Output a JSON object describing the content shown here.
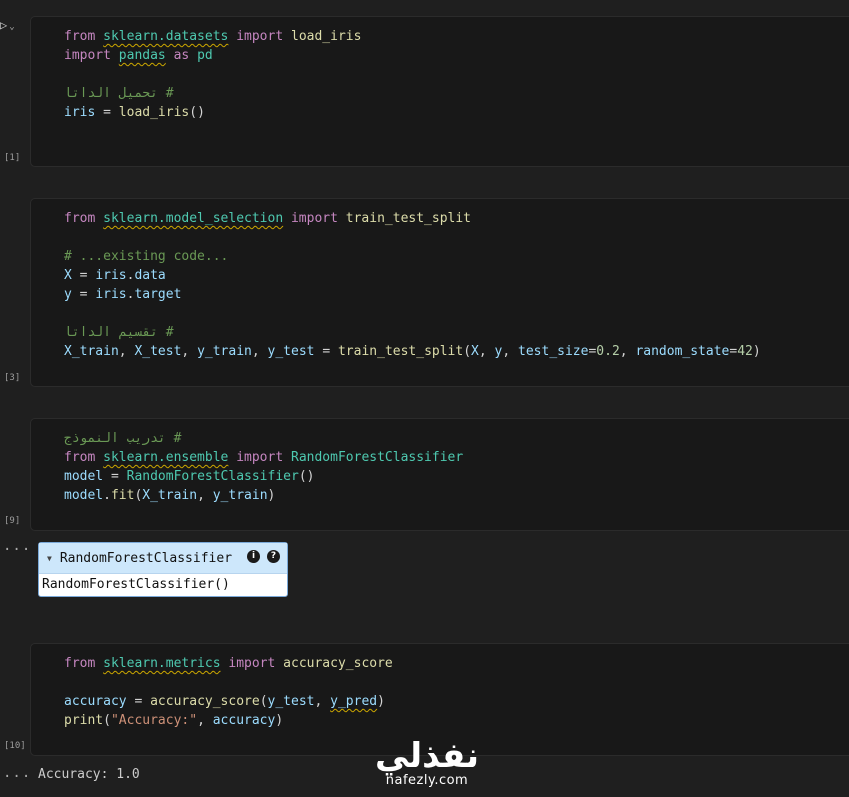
{
  "cells": [
    {
      "exec_count": "[1]",
      "lines": [
        [
          [
            "kw",
            "from "
          ],
          [
            "mod sq",
            "sklearn.datasets"
          ],
          [
            "kw",
            " import "
          ],
          [
            "fn",
            "load_iris"
          ]
        ],
        [
          [
            "kw",
            "import "
          ],
          [
            "mod sq",
            "pandas"
          ],
          [
            "kw",
            " as "
          ],
          [
            "mod",
            "pd"
          ]
        ],
        [],
        [
          [
            "cmt",
            "# تحميل الداتا"
          ]
        ],
        [
          [
            "var",
            "iris"
          ],
          [
            "pln",
            " = "
          ],
          [
            "fn",
            "load_iris"
          ],
          [
            "pln",
            "()"
          ]
        ]
      ]
    },
    {
      "exec_count": "[3]",
      "lines": [
        [
          [
            "kw",
            "from "
          ],
          [
            "mod sq",
            "sklearn.model_selection"
          ],
          [
            "kw",
            " import "
          ],
          [
            "fn",
            "train_test_split"
          ]
        ],
        [],
        [
          [
            "cmt",
            "# ...existing code..."
          ]
        ],
        [
          [
            "var",
            "X"
          ],
          [
            "pln",
            " = "
          ],
          [
            "var",
            "iris"
          ],
          [
            "pln",
            "."
          ],
          [
            "var",
            "data"
          ]
        ],
        [
          [
            "var",
            "y"
          ],
          [
            "pln",
            " = "
          ],
          [
            "var",
            "iris"
          ],
          [
            "pln",
            "."
          ],
          [
            "var",
            "target"
          ]
        ],
        [],
        [
          [
            "cmt",
            "# تقسيم الداتا"
          ]
        ],
        [
          [
            "var",
            "X_train"
          ],
          [
            "pln",
            ", "
          ],
          [
            "var",
            "X_test"
          ],
          [
            "pln",
            ", "
          ],
          [
            "var",
            "y_train"
          ],
          [
            "pln",
            ", "
          ],
          [
            "var",
            "y_test"
          ],
          [
            "pln",
            " = "
          ],
          [
            "fn",
            "train_test_split"
          ],
          [
            "pln",
            "("
          ],
          [
            "var",
            "X"
          ],
          [
            "pln",
            ", "
          ],
          [
            "var",
            "y"
          ],
          [
            "pln",
            ", "
          ],
          [
            "var",
            "test_size"
          ],
          [
            "pln",
            "="
          ],
          [
            "num",
            "0.2"
          ],
          [
            "pln",
            ", "
          ],
          [
            "var",
            "random_state"
          ],
          [
            "pln",
            "="
          ],
          [
            "num",
            "42"
          ],
          [
            "pln",
            ")"
          ]
        ]
      ]
    },
    {
      "exec_count": "[9]",
      "lines": [
        [
          [
            "cmt",
            "# تدريب النموذج"
          ]
        ],
        [
          [
            "kw",
            "from "
          ],
          [
            "mod sq",
            "sklearn.ensemble"
          ],
          [
            "kw",
            " import "
          ],
          [
            "cls",
            "RandomForestClassifier"
          ]
        ],
        [
          [
            "var",
            "model"
          ],
          [
            "pln",
            " = "
          ],
          [
            "cls",
            "RandomForestClassifier"
          ],
          [
            "pln",
            "()"
          ]
        ],
        [
          [
            "var",
            "model"
          ],
          [
            "pln",
            "."
          ],
          [
            "fn",
            "fit"
          ],
          [
            "pln",
            "("
          ],
          [
            "var",
            "X_train"
          ],
          [
            "pln",
            ", "
          ],
          [
            "var",
            "y_train"
          ],
          [
            "pln",
            ")"
          ]
        ]
      ]
    },
    {
      "exec_count": "[10]",
      "lines": [
        [
          [
            "kw",
            "from "
          ],
          [
            "mod sq",
            "sklearn.metrics"
          ],
          [
            "kw",
            " import "
          ],
          [
            "fn",
            "accuracy_score"
          ]
        ],
        [],
        [
          [
            "var",
            "accuracy"
          ],
          [
            "pln",
            " = "
          ],
          [
            "fn",
            "accuracy_score"
          ],
          [
            "pln",
            "("
          ],
          [
            "var",
            "y_test"
          ],
          [
            "pln",
            ", "
          ],
          [
            "var sq",
            "y_pred"
          ],
          [
            "pln",
            ")"
          ]
        ],
        [
          [
            "fn",
            "print"
          ],
          [
            "pln",
            "("
          ],
          [
            "str",
            "\"Accuracy:\""
          ],
          [
            "pln",
            ", "
          ],
          [
            "var",
            "accuracy"
          ],
          [
            "pln",
            ")"
          ]
        ]
      ]
    }
  ],
  "widget": {
    "title": "RandomForestClassifier",
    "info_badge": "i",
    "help_badge": "?",
    "repr": "RandomForestClassifier()"
  },
  "output_ellipsis": "...",
  "output": "Accuracy: 1.0",
  "watermark": {
    "arabic": "نفذلي",
    "latin": "nafezly.com"
  },
  "icons": {
    "run": "play-icon",
    "run_menu": "chevron-down-icon",
    "widget_toggle": "triangle-down-icon"
  }
}
